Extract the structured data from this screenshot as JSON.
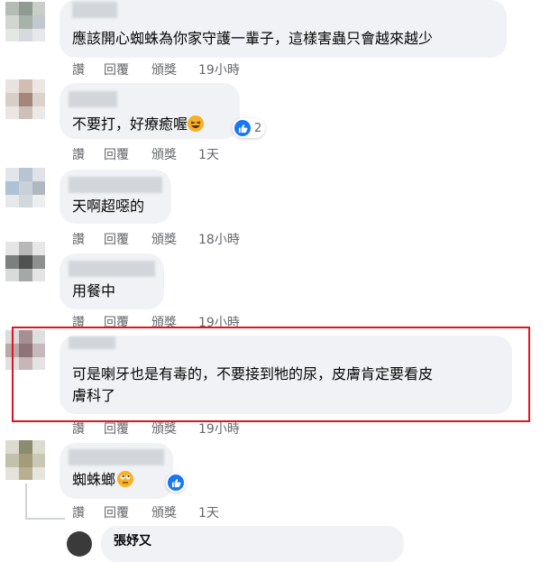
{
  "comments": [
    {
      "text": "應該開心蜘蛛為你家守護一輩子，這樣害蟲只會越來越少",
      "actions": {
        "like": "讚",
        "reply": "回覆",
        "award": "頒獎",
        "time": "19小時"
      }
    },
    {
      "text": "不要打，好療癒喔",
      "emoji": "laughing-emoji",
      "reaction_count": "2",
      "actions": {
        "like": "讚",
        "reply": "回覆",
        "award": "頒獎",
        "time": "1天"
      }
    },
    {
      "text": "天啊超噁的",
      "actions": {
        "like": "讚",
        "reply": "回覆",
        "award": "頒獎",
        "time": "18小時"
      }
    },
    {
      "text": "用餐中",
      "actions": {
        "like": "讚",
        "reply": "回覆",
        "award": "頒獎",
        "time": "19小時"
      }
    },
    {
      "text_line1": "可是喇牙也是有毒的，不要接到牠的尿，皮膚肯定要看皮",
      "text_line2": "膚科了",
      "actions": {
        "like": "讚",
        "reply": "回覆",
        "award": "頒獎",
        "time": "19小時"
      }
    },
    {
      "text": "蜘蛛螂",
      "emoji": "rolling-eyes-emoji",
      "actions": {
        "like": "讚",
        "reply": "回覆",
        "award": "頒獎",
        "time": "1天"
      }
    }
  ],
  "partial_reply": {
    "text": "張妤又"
  },
  "colors": {
    "bubble": "#f0f2f5",
    "action_text": "#65676b",
    "highlight": "#e0141e",
    "like_blue": "#1877f2"
  }
}
